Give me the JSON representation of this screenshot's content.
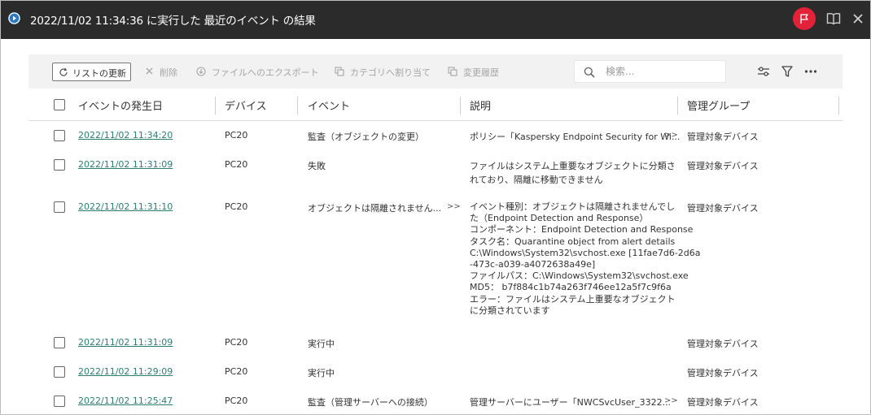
{
  "titlebar": {
    "title": "2022/11/02 11:34:36 に実行した 最近のイベント の結果",
    "accent": "#e3223a"
  },
  "toolbar": {
    "refresh_label": "リストの更新",
    "delete_label": "削除",
    "export_label": "ファイルへのエクスポート",
    "assign_category_label": "カテゴリへ割り当て",
    "history_label": "変更履歴",
    "search_placeholder": "検索..."
  },
  "table": {
    "headers": {
      "date": "イベントの発生日",
      "device": "デバイス",
      "event": "イベント",
      "description": "説明",
      "group": "管理グループ"
    },
    "rows": [
      {
        "date": "2022/11/02 11:34:20",
        "device": "PC20",
        "event": "監査（オブジェクトの変更）",
        "description": "ポリシー「Kaspersky Endpoint Security for Wi...",
        "desc_more": ">>",
        "group": "管理対象デバイス"
      },
      {
        "date": "2022/11/02 11:31:09",
        "device": "PC20",
        "event": "失敗",
        "description_lines": [
          "ファイルはシステム上重要なオブジェクトに分類さ",
          "れており、隔離に移動できません"
        ],
        "group": "管理対象デバイス"
      },
      {
        "date": "2022/11/02 11:31:10",
        "device": "PC20",
        "event": "オブジェクトは隔離されません...",
        "event_more": ">>",
        "description_lines": [
          "イベント種別：オブジェクトは隔離されませんでし",
          "た（Endpoint Detection and Response）",
          "コンポーネント：Endpoint Detection and Response",
          "タスク名：Quarantine object from alert details",
          "C:\\Windows\\System32\\svchost.exe [11fae7d6-2d6a",
          "-473c-a039-a4072638a49e]",
          "ファイルパス：C:\\Windows\\System32\\svchost.exe",
          "MD5： b7f884c1b74a263f746ee12a5f7c9f6a",
          "エラー：ファイルはシステム上重要なオブジェクト",
          "に分類されています"
        ],
        "group": "管理対象デバイス"
      },
      {
        "date": "2022/11/02 11:31:09",
        "device": "PC20",
        "event": "実行中",
        "group": "管理対象デバイス"
      },
      {
        "date": "2022/11/02 11:29:09",
        "device": "PC20",
        "event": "実行中",
        "group": "管理対象デバイス"
      },
      {
        "date": "2022/11/02 11:25:47",
        "device": "PC20",
        "event": "監査（管理サーバーへの接続）",
        "description": "管理サーバーにユーザー「NWCSvcUser_3322...",
        "desc_more": ">>",
        "group": "管理対象デバイス"
      }
    ]
  }
}
